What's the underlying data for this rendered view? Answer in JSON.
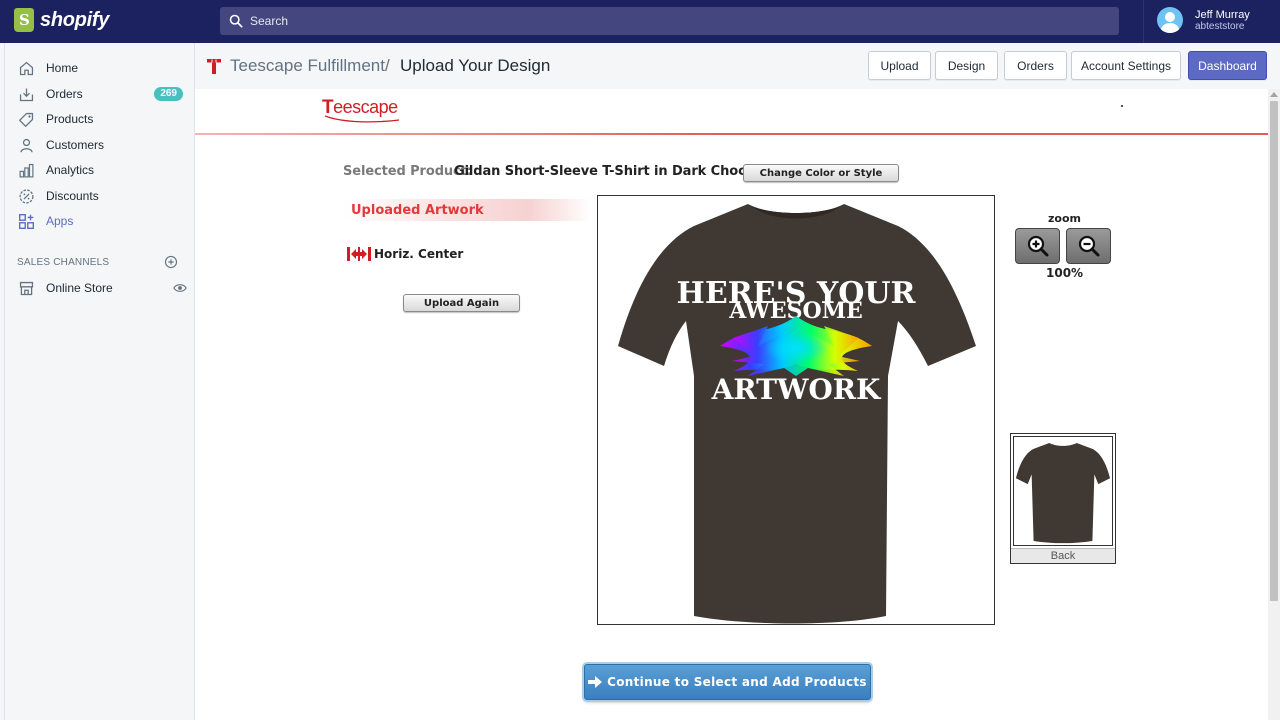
{
  "topbar": {
    "brand": "shopify",
    "search_placeholder": "Search",
    "user_name": "Jeff Murray",
    "user_store": "abteststore"
  },
  "sidebar": {
    "items": [
      {
        "label": "Home",
        "icon": "home-icon"
      },
      {
        "label": "Orders",
        "icon": "orders-icon",
        "badge": "269"
      },
      {
        "label": "Products",
        "icon": "tag-icon"
      },
      {
        "label": "Customers",
        "icon": "person-icon"
      },
      {
        "label": "Analytics",
        "icon": "bar-chart-icon"
      },
      {
        "label": "Discounts",
        "icon": "discount-icon"
      },
      {
        "label": "Apps",
        "icon": "apps-icon",
        "active": true
      }
    ],
    "sales_channels_title": "SALES CHANNELS",
    "channels": [
      {
        "label": "Online Store",
        "icon": "store-icon"
      }
    ]
  },
  "header": {
    "app_name": "Teescape Fulfillment",
    "separator": "/",
    "page_title": "Upload Your Design",
    "buttons": [
      "Upload",
      "Design",
      "Orders",
      "Account Settings",
      "Dashboard"
    ]
  },
  "designer": {
    "logo_text": "eescape",
    "logo_initial": "T",
    "selected_label": "Selected Product:",
    "selected_value": "Gildan Short-Sleeve T-Shirt in Dark Chocolate",
    "change_button": "Change Color or Style",
    "artwork_heading": "Uploaded Artwork",
    "align_label": "Horiz. Center",
    "upload_again": "Upload Again",
    "zoom_label": "zoom",
    "zoom_value": "100%",
    "design_line1": "HERE'S YOUR",
    "design_line2": "AWESOME",
    "design_line3": "ARTWORK",
    "back_label": "Back",
    "continue_button": "Continue to Select and Add Products",
    "shirt_color": "#3f3833",
    "accent_red": "#e23a3a"
  },
  "colors": {
    "topbar": "#1c2260",
    "primary_button": "#5c6ac4",
    "badge": "#47c1bf"
  }
}
